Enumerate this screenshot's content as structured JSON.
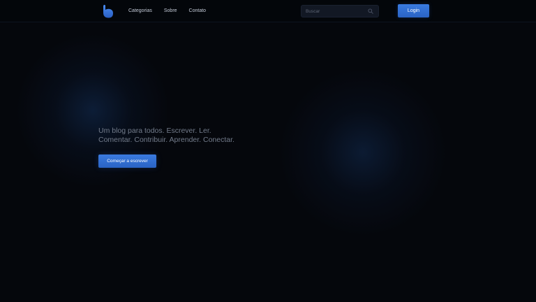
{
  "header": {
    "logo_icon": "droplet-b-logo-icon",
    "nav": [
      {
        "label": "Categorias"
      },
      {
        "label": "Sobre"
      },
      {
        "label": "Contato"
      }
    ],
    "search": {
      "placeholder": "Buscar",
      "value": "",
      "icon": "search-icon"
    },
    "login_label": "Login"
  },
  "hero": {
    "line1": "Um blog para todos. Escrever. Ler.",
    "line2": "Comentar. Contribuir. Aprender. Conectar.",
    "cta_label": "Começar a escrever"
  },
  "colors": {
    "background": "#05070c",
    "accent": "#3a7be0",
    "hero_text": "#727b8a",
    "nav_text": "#c4cbd8"
  }
}
